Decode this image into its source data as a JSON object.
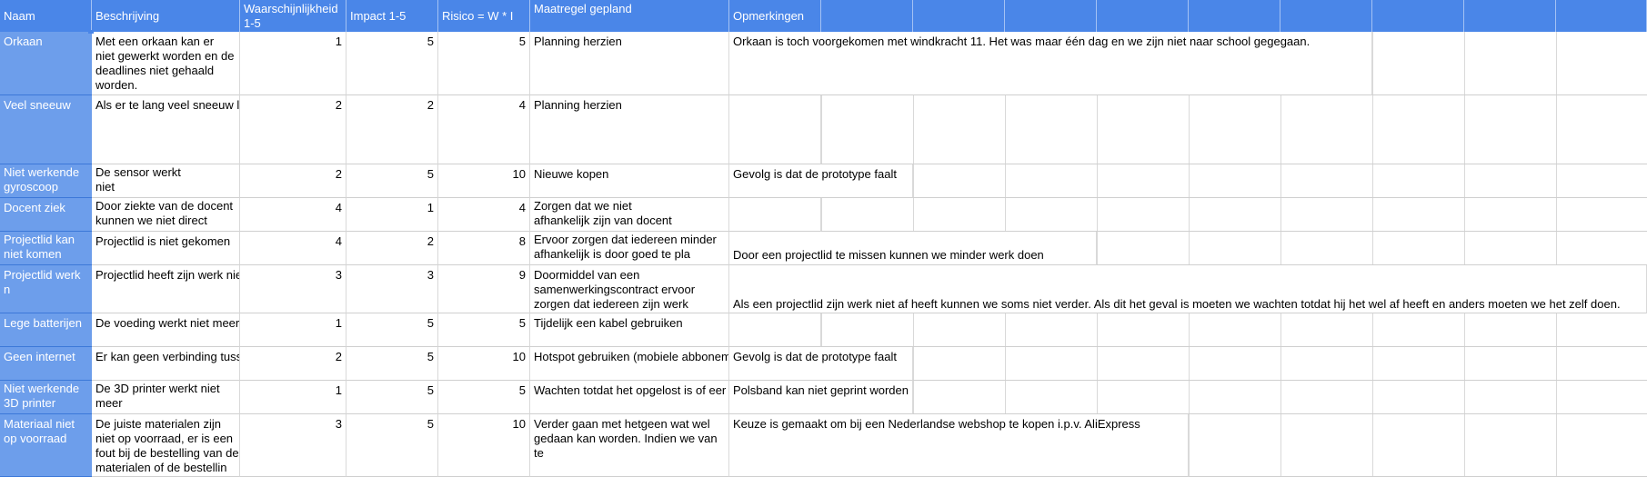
{
  "headers": {
    "naam": "Naam",
    "beschrijving": "Beschrijving",
    "waarschijnlijkheid": "Waarschijnlijkheid 1-5",
    "impact": "Impact 1-5",
    "risico": "Risico = W * I",
    "maatregel": "Maatregel gepland",
    "opmerkingen": "Opmerkingen"
  },
  "rows": [
    {
      "naam": "Orkaan",
      "beschrijving": "Met een orkaan kan er niet gewerkt worden en de deadlines niet gehaald worden.",
      "w": "1",
      "i": "5",
      "r": "5",
      "maatregel": "Planning herzien",
      "opmerking": "Orkaan is toch voorgekomen met windkracht 11. Het was maar één dag en we zijn niet naar school gegegaan."
    },
    {
      "naam": "Veel sneeuw",
      "beschrijving": "Als er te lang veel sneeuw l",
      "w": "2",
      "i": "2",
      "r": "4",
      "maatregel": "Planning herzien",
      "opmerking": ""
    },
    {
      "naam": "Niet werkende gyroscoop",
      "beschrijving": "De sensor werkt niet",
      "w": "2",
      "i": "5",
      "r": "10",
      "maatregel": "Nieuwe kopen",
      "opmerking": "Gevolg is dat de prototype faalt"
    },
    {
      "naam": "Docent ziek",
      "beschrijving": "Door ziekte van de docent kunnen we niet direct antwo",
      "w": "4",
      "i": "1",
      "r": "4",
      "maatregel": "Zorgen dat we niet afhankelijk zijn van docent",
      "opmerking": ""
    },
    {
      "naam": "Projectlid kan niet komen",
      "beschrijving": "Projectlid is niet gekomen",
      "w": "4",
      "i": "2",
      "r": "8",
      "maatregel": "Ervoor zorgen dat iedereen minder afhankelijk is door goed te pla",
      "opmerking": "Door een projectlid te missen kunnen we minder werk doen"
    },
    {
      "naam": "Projectlid werk n",
      "beschrijving": "Projectlid heeft zijn werk nie",
      "w": "3",
      "i": "3",
      "r": "9",
      "maatregel": "Doormiddel van een samenwerkingscontract ervoor zorgen dat iedereen zijn werk doet",
      "opmerking": "Als een projectlid zijn werk niet af heeft kunnen we soms niet verder. Als dit het geval is moeten we wachten totdat hij het wel af heeft en anders moeten we het zelf doen."
    },
    {
      "naam": "Lege batterijen",
      "beschrijving": "De voeding werkt niet meer",
      "w": "1",
      "i": "5",
      "r": "5",
      "maatregel": "Tijdelijk een kabel gebruiken",
      "opmerking": ""
    },
    {
      "naam": "Geen internet",
      "beschrijving": "Er kan geen verbinding tuss",
      "w": "2",
      "i": "5",
      "r": "10",
      "maatregel": "Hotspot gebruiken (mobiele abbonem",
      "opmerking": "Gevolg is dat de prototype faalt"
    },
    {
      "naam": "Niet werkende 3D printer",
      "beschrijving": "De 3D printer werkt niet meer",
      "w": "1",
      "i": "5",
      "r": "5",
      "maatregel": "Wachten totdat het opgelost is of eer",
      "opmerking": "Polsband kan niet geprint worden"
    },
    {
      "naam": "Materiaal niet op voorraad",
      "beschrijving": "De juiste materialen zijn niet op voorraad, er is een fout bij de bestelling van de materialen of de bestellin",
      "w": "3",
      "i": "5",
      "r": "10",
      "maatregel": "Verder gaan met hetgeen wat wel gedaan kan worden. Indien we van te",
      "opmerking": "Keuze is gemaakt om bij een Nederlandse webshop te kopen i.p.v. AliExpress"
    }
  ]
}
